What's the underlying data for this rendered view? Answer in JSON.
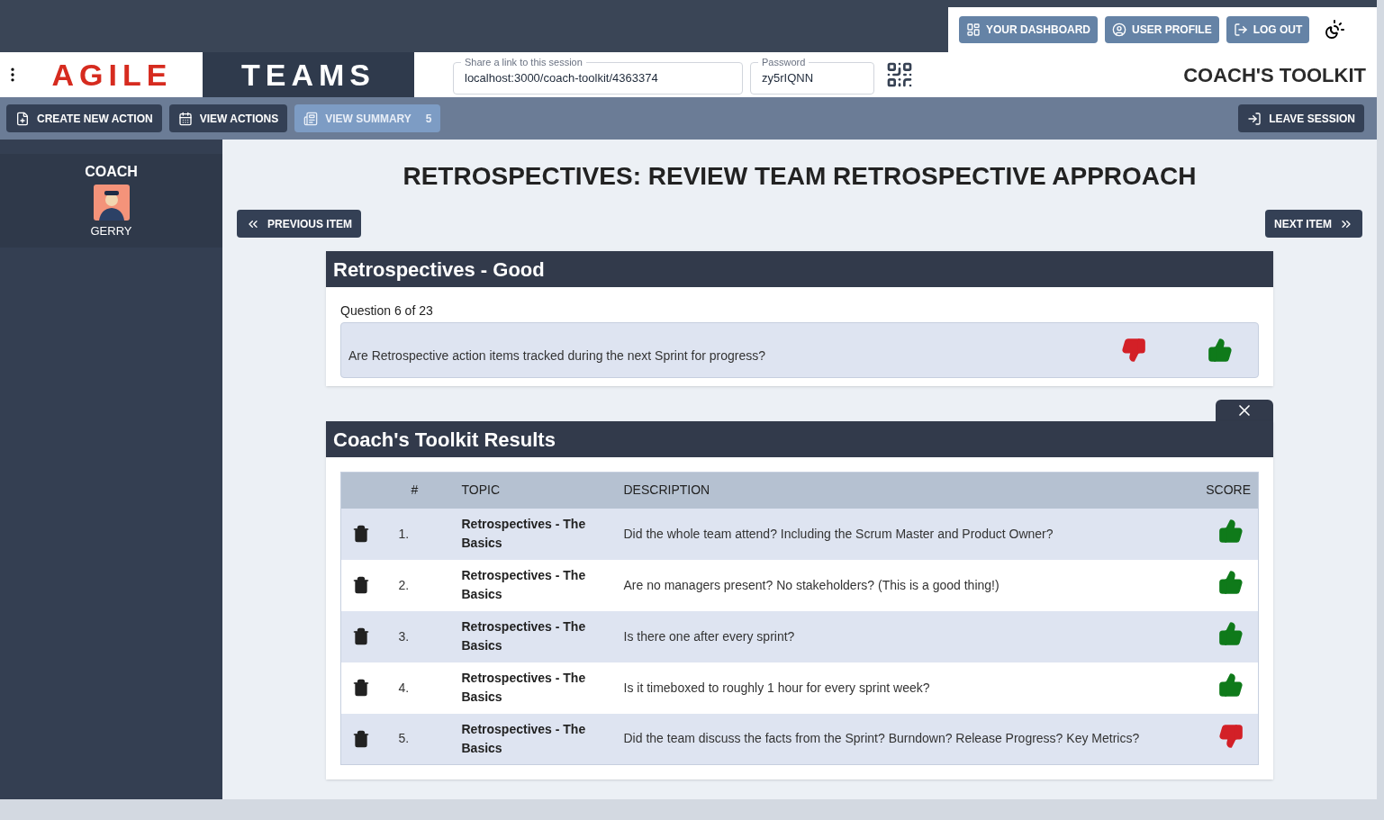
{
  "top_buttons": [
    {
      "label": "YOUR DASHBOARD",
      "kind": "dashboard"
    },
    {
      "label": "USER PROFILE",
      "kind": "profile"
    },
    {
      "label": "LOG OUT",
      "kind": "logout"
    }
  ],
  "logo": {
    "left": "AGILE",
    "right": "TEAMS"
  },
  "share": {
    "label": "Share a link to this session",
    "value": "localhost:3000/coach-toolkit/4363374"
  },
  "password": {
    "label": "Password",
    "value": "zy5rIQNN"
  },
  "page_title": "COACH'S TOOLKIT",
  "toolbar": [
    {
      "label": "CREATE NEW ACTION",
      "kind": "create",
      "selected": false
    },
    {
      "label": "VIEW ACTIONS",
      "kind": "actions",
      "selected": false
    },
    {
      "label": "VIEW SUMMARY",
      "kind": "summary",
      "selected": true,
      "count": "5"
    }
  ],
  "leave": "LEAVE SESSION",
  "sidebar": {
    "role": "COACH",
    "name": "GERRY"
  },
  "heading": "RETROSPECTIVES: REVIEW TEAM RETROSPECTIVE APPROACH",
  "prev": "PREVIOUS ITEM",
  "next": "NEXT ITEM",
  "question_card": {
    "title": "Retrospectives - Good",
    "counter": "Question 6 of 23",
    "question": "Are Retrospective action items tracked during the next Sprint for progress?"
  },
  "results": {
    "title": "Coach's Toolkit Results",
    "columns": [
      "#",
      "TOPIC",
      "DESCRIPTION",
      "SCORE"
    ],
    "rows": [
      {
        "num": "1.",
        "topic": "Retrospectives - The Basics",
        "description": "Did the whole team attend? Including the Scrum Master and Product Owner?",
        "kind": "up"
      },
      {
        "num": "2.",
        "topic": "Retrospectives - The Basics",
        "description": "Are no managers present? No stakeholders? (This is a good thing!)",
        "kind": "up"
      },
      {
        "num": "3.",
        "topic": "Retrospectives - The Basics",
        "description": "Is there one after every sprint?",
        "kind": "up"
      },
      {
        "num": "4.",
        "topic": "Retrospectives - The Basics",
        "description": "Is it timeboxed to roughly 1 hour for every sprint week?",
        "kind": "up"
      },
      {
        "num": "5.",
        "topic": "Retrospectives - The Basics",
        "description": "Did the team discuss the facts from the Sprint? Burndown? Release Progress? Key Metrics?",
        "kind": "down"
      }
    ]
  }
}
